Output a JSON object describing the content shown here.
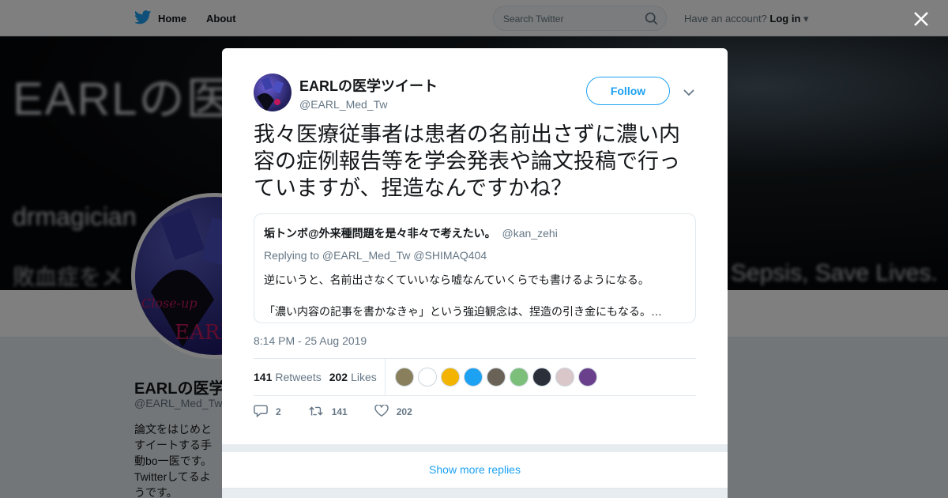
{
  "topbar": {
    "home_label": "Home",
    "about_label": "About",
    "search_placeholder": "Search Twitter",
    "account_prompt": "Have an account?",
    "login_label": "Log in"
  },
  "banner": {
    "line1": "EARLの医",
    "line2": "drmagician",
    "line3": "敗血症をメ",
    "line4": "Sepsis, Save Lives."
  },
  "profile": {
    "name": "EARLの医学",
    "handle": "@EARL_Med_Tw",
    "bio": "論文をはじめとすイートする手動bo一医です。Twitterしてるようです。"
  },
  "tweet": {
    "author_name": "EARLの医学ツイート",
    "author_handle": "@EARL_Med_Tw",
    "follow_label": "Follow",
    "text": "我々医療従事者は患者の名前出さずに濃い内容の症例報告等を学会発表や論文投稿で行っていますが、捏造なんですかね？",
    "quote": {
      "name": "垢トンボ@外来種問題を是々非々で考えたい。",
      "handle": "@kan_zehi",
      "replying_to": "Replying to @EARL_Med_Tw @SHIMAQ404",
      "line1": "逆にいうと、名前出さなくていいなら嘘なんていくらでも書けるようになる。",
      "line2": "「濃い内容の記事を書かなきゃ」という強迫観念は、捏造の引き金にもなる。…"
    },
    "timestamp": "8:14 PM - 25 Aug 2019",
    "retweets_count": "141",
    "retweets_label": "Retweets",
    "likes_count": "202",
    "likes_label": "Likes",
    "reply_count": "2",
    "retweet_action_count": "141",
    "like_action_count": "202",
    "show_more": "Show more replies"
  },
  "colors": {
    "brand": "#1da1f2",
    "text": "#14171a",
    "secondary": "#657786",
    "border": "#e1e8ed",
    "backdrop": "#e6ecf0"
  },
  "liker_colors": [
    "#8a7f5c",
    "#ffffff",
    "#f2b400",
    "#1da1f2",
    "#6b6257",
    "#7bbf7a",
    "#2b2f3a",
    "#d9c7c9",
    "#6a3f8c"
  ]
}
